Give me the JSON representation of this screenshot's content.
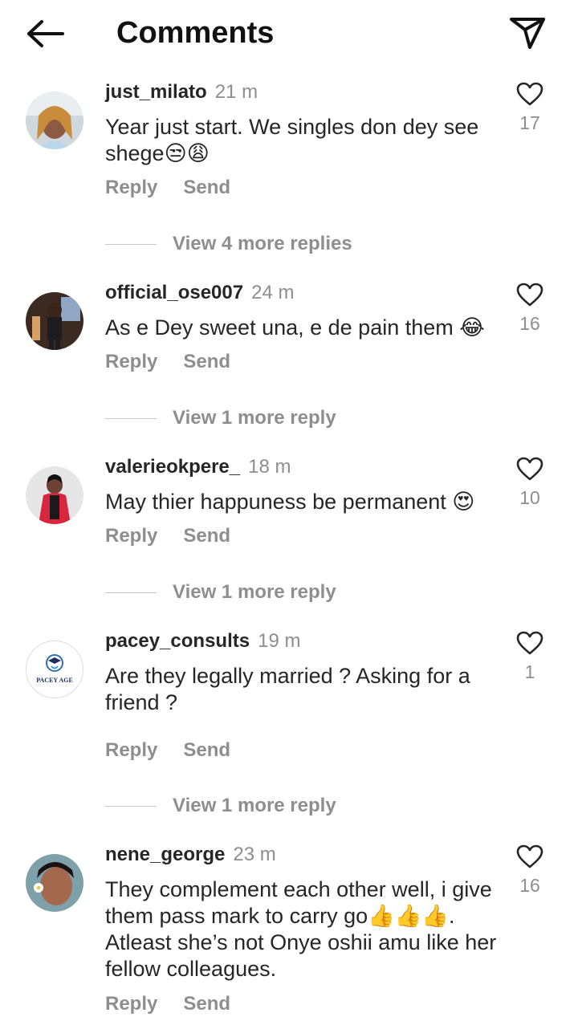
{
  "header": {
    "title": "Comments",
    "back_icon": "arrow-left-icon",
    "share_icon": "paper-plane-icon"
  },
  "colors": {
    "text": "#262626",
    "secondary": "#8e8e8e",
    "divider": "#c7c7c7"
  },
  "comments": [
    {
      "username": "just_milato",
      "time": "21 m",
      "text": "Year just start. We singles don dey see shege😒😩",
      "likes": "17",
      "reply_label": "Reply",
      "send_label": "Send",
      "more_replies": "View 4 more replies"
    },
    {
      "username": "official_ose007",
      "time": "24 m",
      "text": "As e Dey sweet una, e de pain them 😂",
      "likes": "16",
      "reply_label": "Reply",
      "send_label": "Send",
      "more_replies": "View 1 more reply"
    },
    {
      "username": "valerieokpere_",
      "time": "18 m",
      "text": "May thier happuness be permanent 😍",
      "likes": "10",
      "reply_label": "Reply",
      "send_label": "Send",
      "more_replies": "View 1 more reply"
    },
    {
      "username": "pacey_consults",
      "time": "19 m",
      "text": "Are they legally married ? Asking for a friend ?",
      "likes": "1",
      "reply_label": "Reply",
      "send_label": "Send",
      "more_replies": "View 1 more reply",
      "avatar_logo_text": "PACEY AGE"
    },
    {
      "username": "nene_george",
      "time": "23 m",
      "text": "They complement each other well, i give them pass mark to carry go👍👍👍. Atleast she’s not Onye oshii amu like her fellow colleagues.",
      "likes": "16",
      "reply_label": "Reply",
      "send_label": "Send"
    }
  ]
}
